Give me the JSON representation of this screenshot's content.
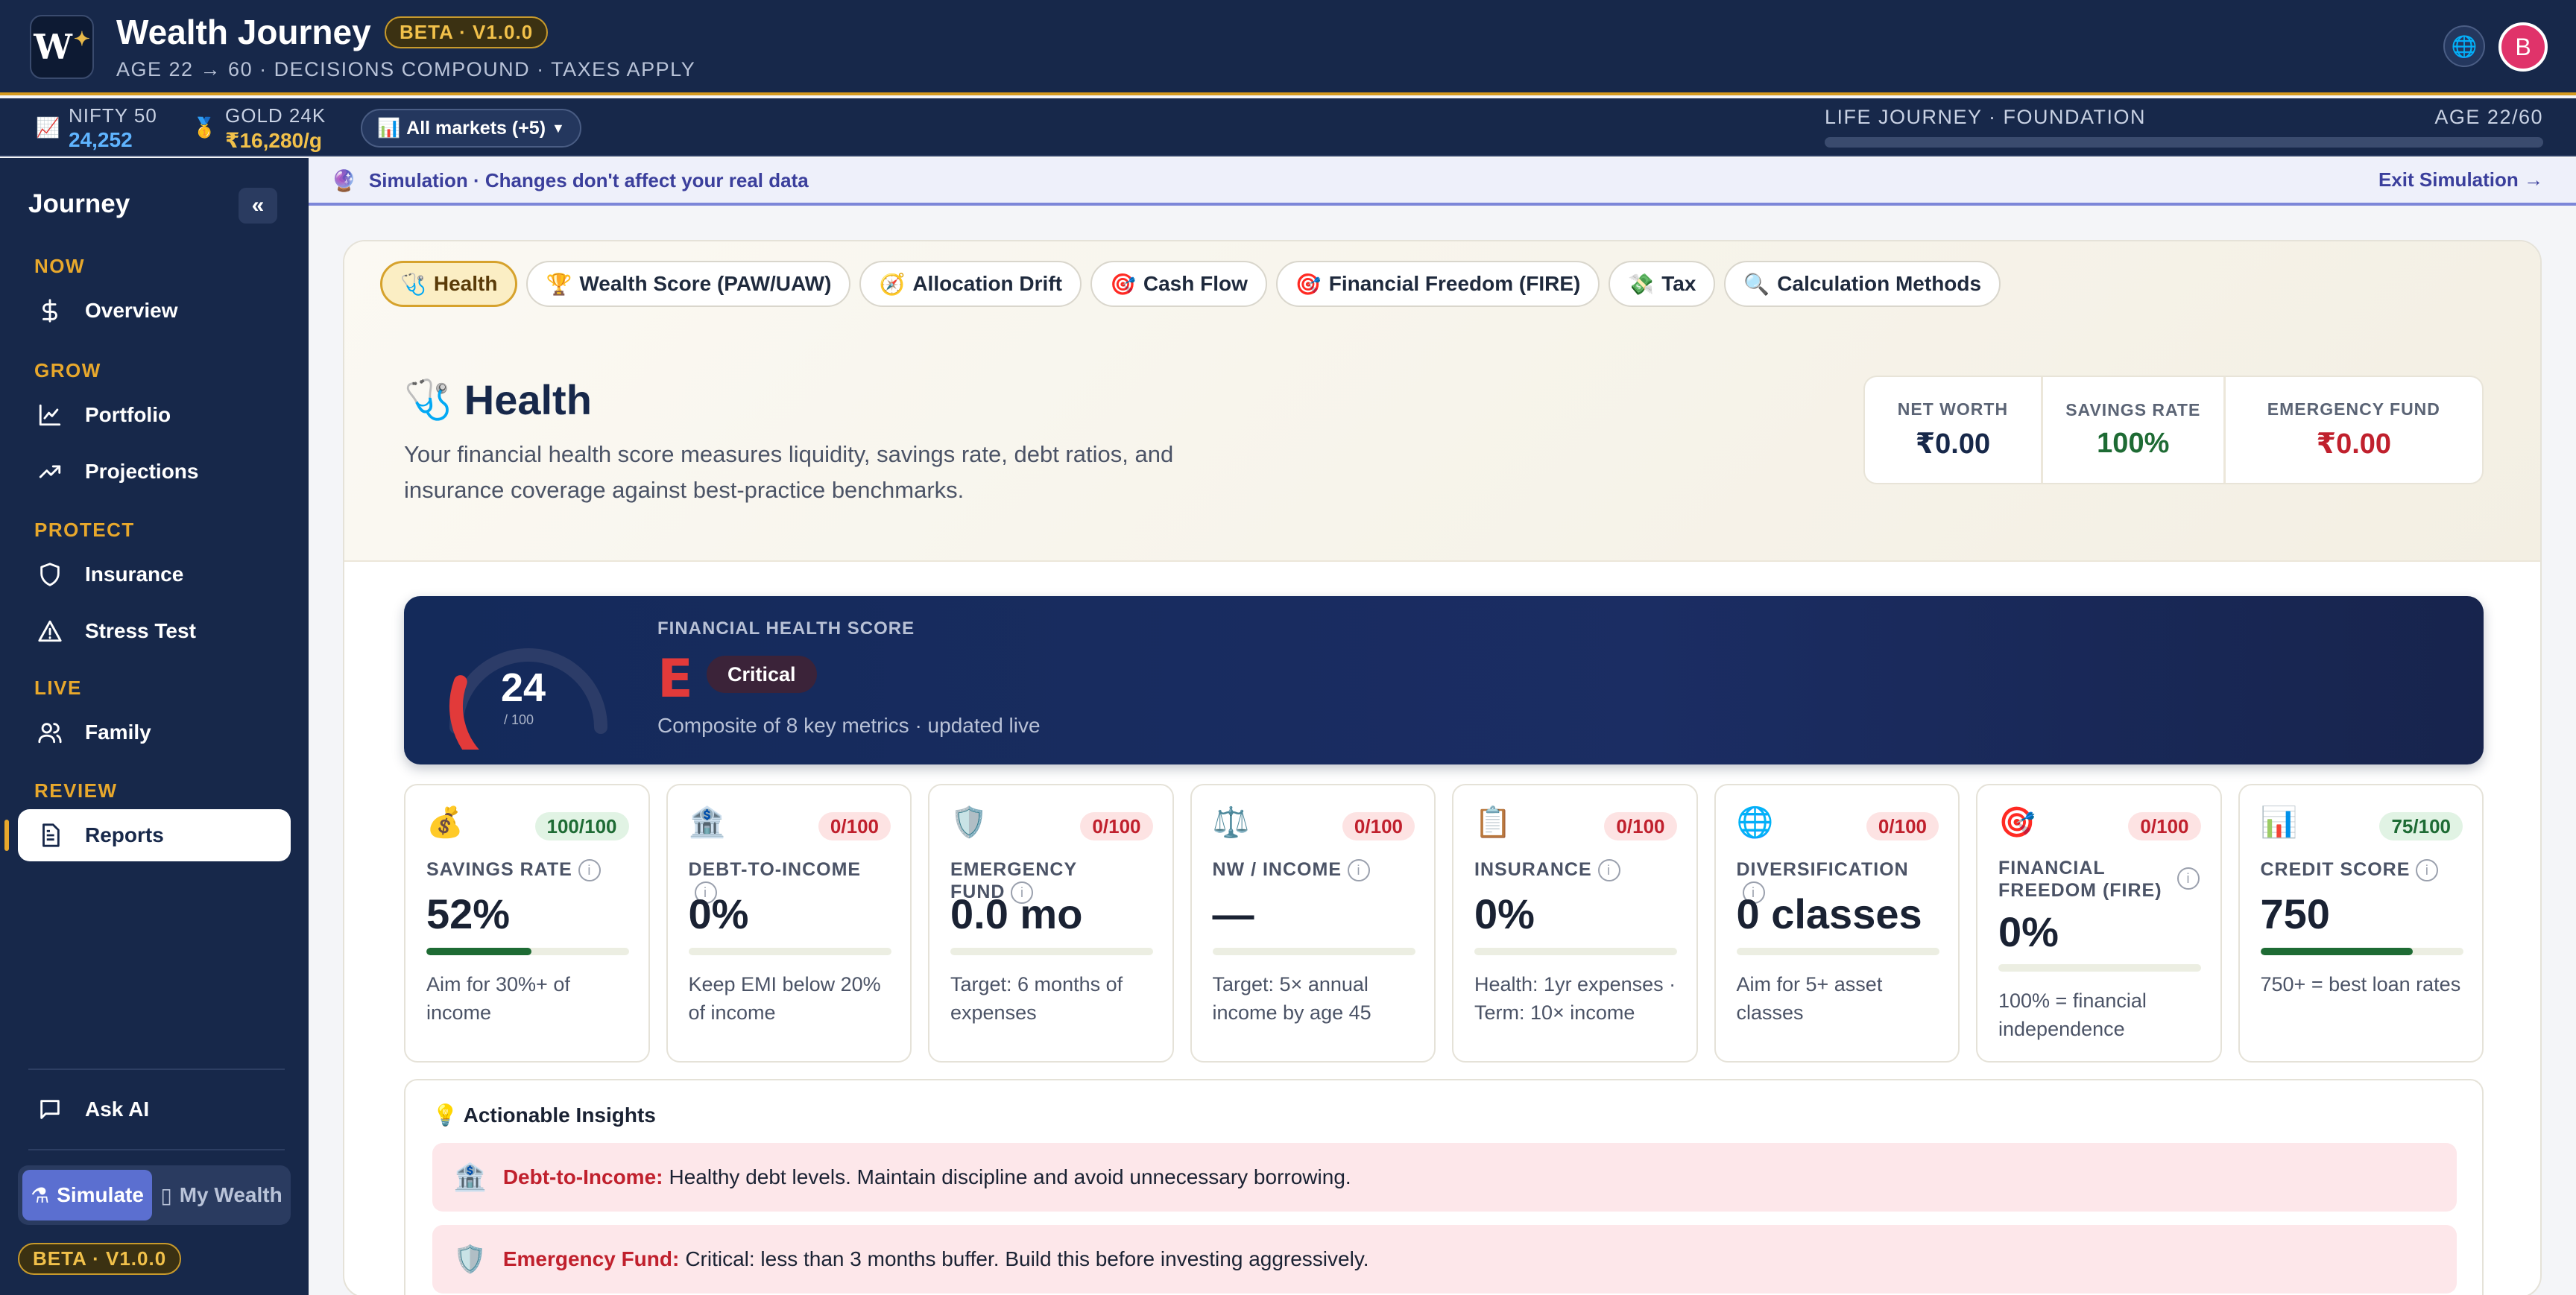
{
  "header": {
    "logo_text": "W",
    "title": "Wealth Journey",
    "badge": "BETA · V1.0.0",
    "subtitle": "AGE 22 → 60 · DECISIONS COMPOUND · TAXES APPLY",
    "avatar_letter": "B"
  },
  "ticker": {
    "nifty": {
      "name": "NIFTY 50",
      "value": "24,252"
    },
    "gold": {
      "name": "GOLD 24K",
      "value": "₹16,280/g"
    },
    "markets_label": "All markets (+5)",
    "journey_label": "LIFE JOURNEY · FOUNDATION",
    "journey_age": "AGE 22/60",
    "journey_progress": 0
  },
  "sidebar": {
    "title": "Journey",
    "collapse": "«",
    "groups": {
      "now": "NOW",
      "grow": "GROW",
      "protect": "PROTECT",
      "live": "LIVE",
      "review": "REVIEW"
    },
    "items": {
      "overview": "Overview",
      "portfolio": "Portfolio",
      "projections": "Projections",
      "insurance": "Insurance",
      "stress_test": "Stress Test",
      "family": "Family",
      "reports": "Reports",
      "ask_ai": "Ask AI"
    },
    "mode": {
      "simulate": "Simulate",
      "my_wealth": "My Wealth"
    },
    "badge": "BETA · V1.0.0"
  },
  "simulation": {
    "text": "Simulation · Changes don't affect your real data",
    "exit": "Exit Simulation →"
  },
  "tabs": [
    {
      "icon": "🩺",
      "label": "Health"
    },
    {
      "icon": "🏆",
      "label": "Wealth Score (PAW/UAW)"
    },
    {
      "icon": "🧭",
      "label": "Allocation Drift"
    },
    {
      "icon": "🎯",
      "label": "Cash Flow"
    },
    {
      "icon": "🎯",
      "label": "Financial Freedom (FIRE)"
    },
    {
      "icon": "💸",
      "label": "Tax"
    },
    {
      "icon": "🔍",
      "label": "Calculation Methods"
    }
  ],
  "section": {
    "title": "Health",
    "description": "Your financial health score measures liquidity, savings rate, debt ratios, and insurance coverage against best-practice benchmarks."
  },
  "kpis": [
    {
      "label": "NET WORTH",
      "value": "₹0.00",
      "color": "#17284a"
    },
    {
      "label": "SAVINGS RATE",
      "value": "100%",
      "color": "#1e6b34"
    },
    {
      "label": "EMERGENCY FUND",
      "value": "₹0.00",
      "color": "#c0202d"
    }
  ],
  "score": {
    "label": "FINANCIAL HEALTH SCORE",
    "value": "24",
    "max": "/ 100",
    "fraction": 0.24,
    "grade": "E",
    "status": "Critical",
    "note": "Composite of 8 key metrics · updated live",
    "color": "#e23a3a"
  },
  "metrics": [
    {
      "icon": "💰",
      "score": "100/100",
      "good": true,
      "label": "SAVINGS RATE",
      "value": "52%",
      "progress": 52,
      "desc": "Aim for 30%+ of income"
    },
    {
      "icon": "🏦",
      "score": "0/100",
      "good": false,
      "label": "DEBT-TO-INCOME",
      "value": "0%",
      "progress": 0,
      "desc": "Keep EMI below 20% of income"
    },
    {
      "icon": "🛡️",
      "score": "0/100",
      "good": false,
      "label": "EMERGENCY FUND",
      "value": "0.0 mo",
      "progress": 0,
      "desc": "Target: 6 months of expenses"
    },
    {
      "icon": "⚖️",
      "score": "0/100",
      "good": false,
      "label": "NW / INCOME",
      "value": "—",
      "progress": 0,
      "desc": "Target: 5× annual income by age 45"
    },
    {
      "icon": "📋",
      "score": "0/100",
      "good": false,
      "label": "INSURANCE",
      "value": "0%",
      "progress": 0,
      "desc": "Health: 1yr expenses · Term: 10× income"
    },
    {
      "icon": "🌐",
      "score": "0/100",
      "good": false,
      "label": "DIVERSIFICATION",
      "value": "0 classes",
      "progress": 0,
      "desc": "Aim for 5+ asset classes"
    },
    {
      "icon": "🎯",
      "score": "0/100",
      "good": false,
      "label": "FINANCIAL FREEDOM (FIRE)",
      "value": "0%",
      "progress": 0,
      "desc": "100% = financial independence"
    },
    {
      "icon": "📊",
      "score": "75/100",
      "good": true,
      "label": "CREDIT SCORE",
      "value": "750",
      "progress": 75,
      "desc": "750+ = best loan rates"
    }
  ],
  "insights": {
    "title": "Actionable Insights",
    "rows": [
      {
        "icon": "🏦",
        "title": "Debt-to-Income:",
        "text": "Healthy debt levels. Maintain discipline and avoid unnecessary borrowing."
      },
      {
        "icon": "🛡️",
        "title": "Emergency Fund:",
        "text": "Critical: less than 3 months buffer. Build this before investing aggressively."
      }
    ]
  }
}
